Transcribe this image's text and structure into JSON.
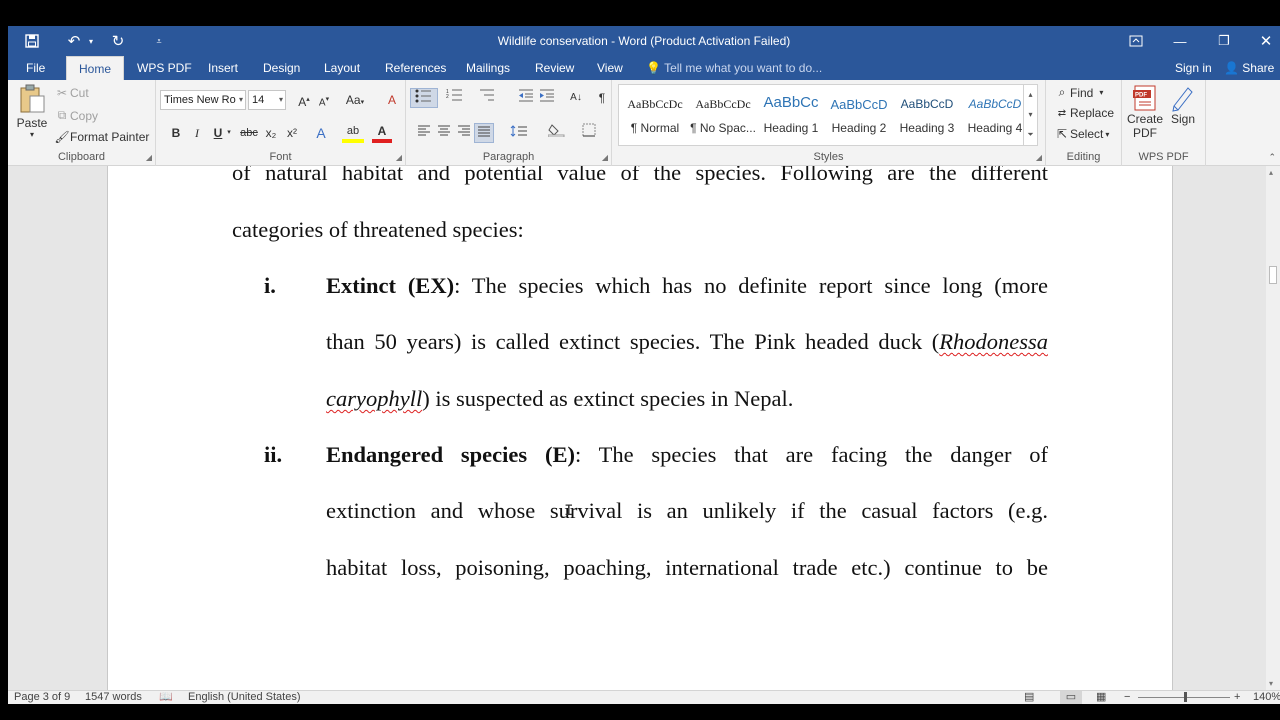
{
  "window": {
    "title": "Wildlife conservation - Word (Product Activation Failed)",
    "controls": {
      "ribbon_display": "▭",
      "minimize": "—",
      "restore": "❐",
      "close": "✕"
    }
  },
  "qat": {
    "save": "💾",
    "undo": "↶",
    "redo": "↻",
    "customize": "⩡"
  },
  "tabs": [
    "File",
    "Home",
    "WPS PDF",
    "Insert",
    "Design",
    "Layout",
    "References",
    "Mailings",
    "Review",
    "View"
  ],
  "tell_me": "Tell me what you want to do...",
  "account": {
    "sign_in": "Sign in",
    "share": "Share"
  },
  "clipboard": {
    "paste": "Paste",
    "cut": "Cut",
    "copy": "Copy",
    "format_painter": "Format Painter",
    "label": "Clipboard"
  },
  "font": {
    "name": "Times New Ro",
    "size": "14",
    "label": "Font",
    "bold": "B",
    "italic": "I",
    "underline": "U",
    "strike": "abc",
    "subscript": "x₂",
    "superscript": "x²",
    "grow": "A",
    "shrink": "A",
    "change_case": "Aa",
    "clear": "A",
    "effects": "A",
    "highlight": "ab",
    "color": "A"
  },
  "paragraph": {
    "label": "Paragraph",
    "show_marks": "¶"
  },
  "styles": {
    "label": "Styles",
    "items": [
      {
        "sample": "AaBbCcDc",
        "name": "¶ Normal"
      },
      {
        "sample": "AaBbCcDc",
        "name": "¶ No Spac..."
      },
      {
        "sample": "AaBbCc",
        "name": "Heading 1"
      },
      {
        "sample": "AaBbCcD",
        "name": "Heading 2"
      },
      {
        "sample": "AaBbCcD",
        "name": "Heading 3"
      },
      {
        "sample": "AaBbCcD",
        "name": "Heading 4"
      }
    ]
  },
  "editing": {
    "find": "Find",
    "replace": "Replace",
    "select": "Select",
    "label": "Editing"
  },
  "wps": {
    "create": "Create",
    "pdf": "PDF",
    "sign": "Sign",
    "label": "WPS PDF",
    "badge": "PDF"
  },
  "document": {
    "l1": "of natural habitat and potential value of the species. Following are the different",
    "l2": "categories of threatened species:",
    "item1_num": "i.",
    "item1_bold": "Extinct (EX)",
    "item1_l1": ": The species which has no definite report since long (more",
    "item1_l2a": "than 50 years) is called extinct species. The Pink headed duck (",
    "item1_l2b": "Rhodonessa",
    "item1_l3a": "caryophyll",
    "item1_l3b": ") is suspected as extinct species in Nepal.",
    "item2_num": "ii.",
    "item2_bold": "Endangered species (E)",
    "item2_l1": ": The species that are facing the danger of",
    "item2_l2": "extinction and whose survival is an unlikely if the casual factors (e.g.",
    "item2_l3": "habitat loss, poisoning, poaching, international trade etc.) continue to be"
  },
  "status": {
    "page": "Page 3 of 9",
    "words": "1547 words",
    "language": "English (United States)",
    "zoom": "140%"
  }
}
